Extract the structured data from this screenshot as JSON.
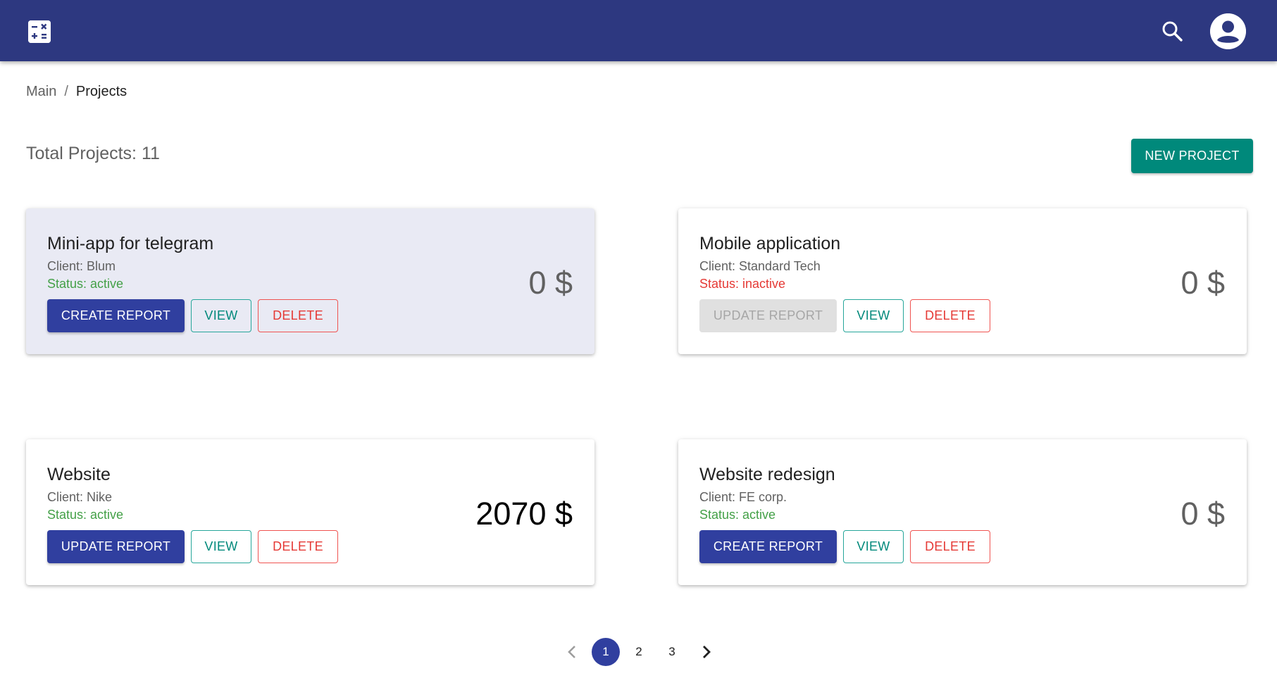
{
  "header": {
    "logo_icon": "calculator-icon",
    "search_icon": "search-icon",
    "account_icon": "account-circle-icon",
    "background": "#2d3880"
  },
  "breadcrumb": {
    "items": [
      "Main",
      "Projects"
    ],
    "separator": "/"
  },
  "summary": {
    "total_label": "Total Projects: 11"
  },
  "actions": {
    "new_project_label": "NEW PROJECT"
  },
  "projects": [
    {
      "title": "Mini-app for telegram",
      "client": "Client: Blum",
      "status": "Status: active",
      "amount": "0 $",
      "report_label": "CREATE REPORT",
      "view_label": "VIEW",
      "delete_label": "DELETE"
    },
    {
      "title": "Mobile application",
      "client": "Client: Standard Tech",
      "status": "Status: inactive",
      "amount": "0 $",
      "report_label": "UPDATE REPORT",
      "view_label": "VIEW",
      "delete_label": "DELETE"
    },
    {
      "title": "Website",
      "client": "Client: Nike",
      "status": "Status: active",
      "amount": "2070 $",
      "report_label": "UPDATE REPORT",
      "view_label": "VIEW",
      "delete_label": "DELETE"
    },
    {
      "title": "Website redesign",
      "client": "Client: FE corp.",
      "status": "Status: active",
      "amount": "0 $",
      "report_label": "CREATE REPORT",
      "view_label": "VIEW",
      "delete_label": "DELETE"
    }
  ],
  "pagination": {
    "prev_icon": "chevron-left-icon",
    "next_icon": "chevron-right-icon",
    "pages": [
      "1",
      "2",
      "3"
    ],
    "current": "1"
  },
  "colors": {
    "primary": "#303f9f",
    "teal": "#00897b",
    "active": "#43a047",
    "inactive": "#e53935"
  }
}
